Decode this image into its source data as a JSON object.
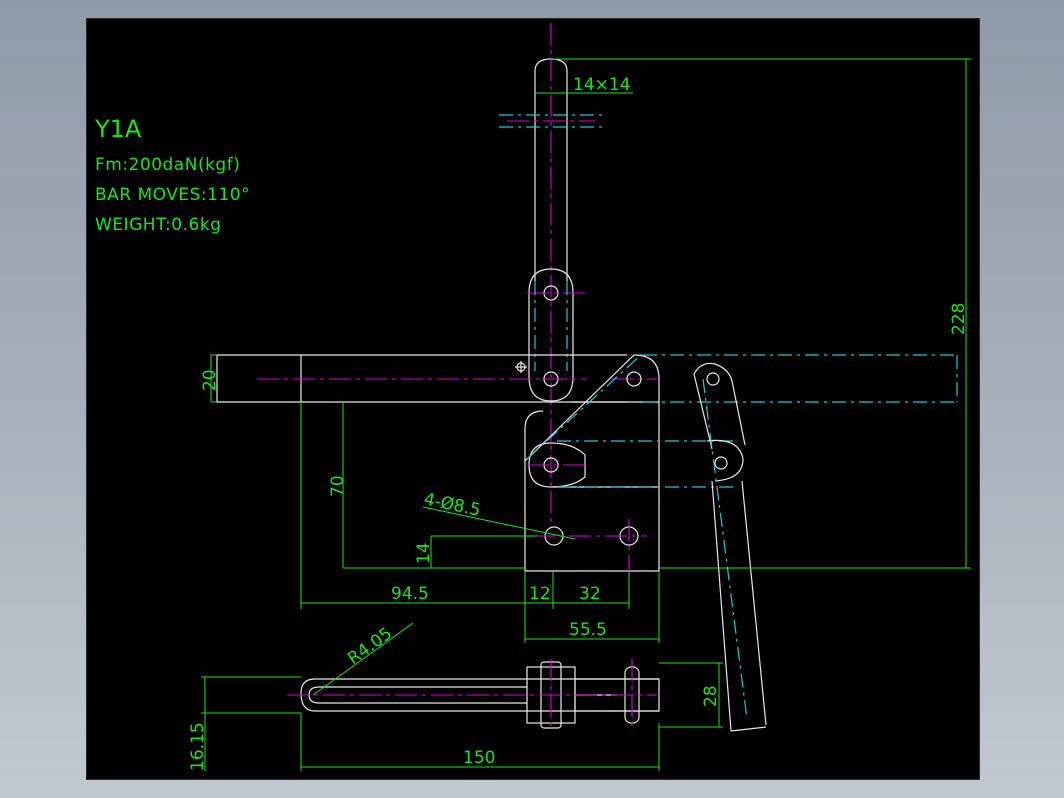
{
  "notes": {
    "model": "Y1A",
    "force": "Fm:200daN(kgf)",
    "bar_moves": "BAR MOVES:110°",
    "weight": "WEIGHT:0.6kg"
  },
  "dimensions": {
    "bar_section": "14×14",
    "overall_height": "228",
    "arm_width": "20",
    "height_70": "70",
    "hole_spec": "4-Ø8.5",
    "offset_14": "14",
    "len_94_5": "94.5",
    "len_12": "12",
    "len_32": "32",
    "len_55_5": "55.5",
    "radius": "R4.05",
    "width_28": "28",
    "height_16_15": "16.15",
    "len_150": "150"
  },
  "colors": {
    "background": "#000000",
    "object": "#e8e8e8",
    "hidden": "#1fc8d8",
    "centerline": "#e000e0",
    "dimension": "#19e619"
  }
}
